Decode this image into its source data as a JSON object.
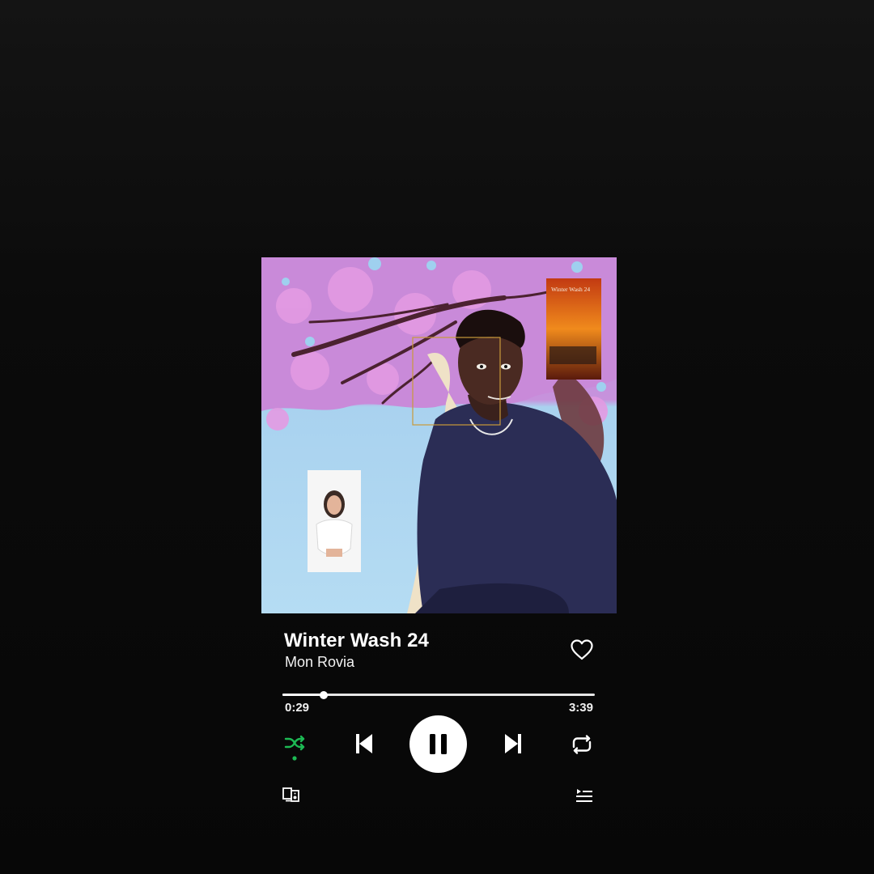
{
  "track": {
    "title": "Winter Wash 24",
    "artist": "Mon Rovia",
    "cover_text": "Winter Wash 24"
  },
  "playback": {
    "elapsed": "0:29",
    "total": "3:39",
    "progress_fraction": 0.132,
    "state": "playing",
    "shuffle_enabled": true
  },
  "icons": {
    "like": "heart-outline-icon",
    "shuffle": "shuffle-icon",
    "previous": "skip-previous-icon",
    "play_pause": "pause-icon",
    "next": "skip-next-icon",
    "repeat": "repeat-icon",
    "devices": "connect-devices-icon",
    "queue": "queue-icon"
  },
  "colors": {
    "accent": "#1DB954",
    "foreground": "#FFFFFF",
    "background": "#0B0B0B"
  }
}
